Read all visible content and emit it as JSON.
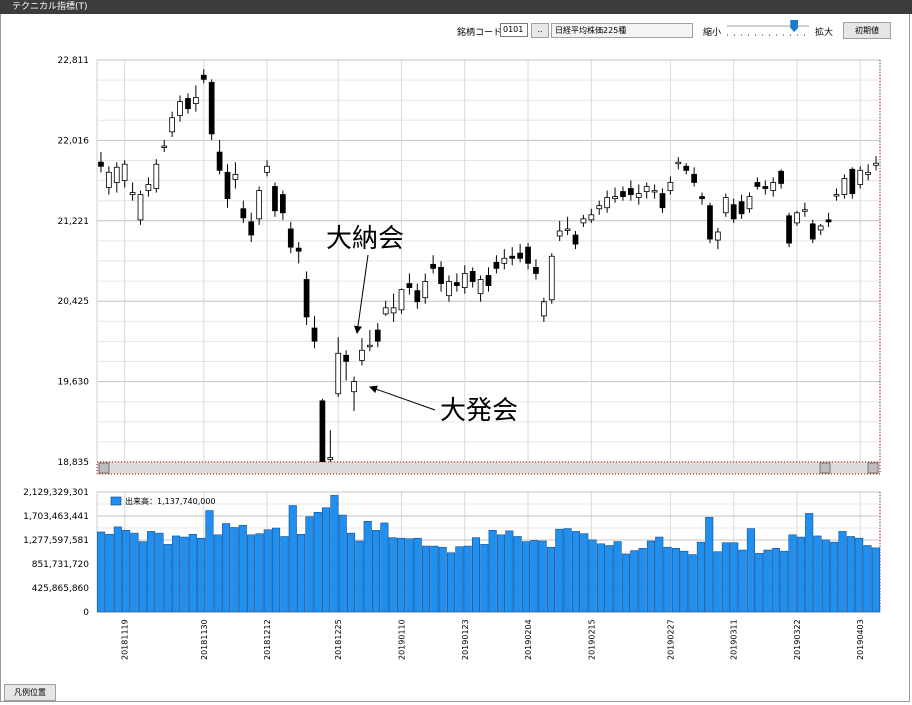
{
  "window": {
    "title": "テクニカル指標(T)"
  },
  "toolbar": {
    "code_label": "銘柄コード:",
    "code_value": "0101",
    "code_button": "..",
    "name_value": "日経平均株価225種",
    "zoom_out_label": "縮小",
    "zoom_in_label": "拡大",
    "zoom_level": 0.82,
    "reset_button": "初期値"
  },
  "footer": {
    "legend_button": "凡例位置"
  },
  "colors": {
    "volume_bar": "#1f8ff0",
    "up_body": "#ffffff",
    "down_body": "#000000",
    "grid": "#d9d9d9"
  },
  "chart_data": [
    {
      "type": "candlestick",
      "ylim": [
        18835,
        22811
      ],
      "yticks": [
        "22,811",
        "22,016",
        "21,221",
        "20,425",
        "19,630",
        "18,835"
      ],
      "annotations": [
        {
          "text": "大納会",
          "points_to": "20181228"
        },
        {
          "text": "大発会",
          "points_to": "20190104"
        }
      ],
      "candles": [
        [
          21800,
          21760,
          21900,
          21700
        ],
        [
          21550,
          21700,
          21760,
          21480
        ],
        [
          21600,
          21750,
          21800,
          21500
        ],
        [
          21620,
          21780,
          21820,
          21550
        ],
        [
          21480,
          21500,
          21600,
          21420
        ],
        [
          21230,
          21480,
          21520,
          21180
        ],
        [
          21520,
          21580,
          21650,
          21460
        ],
        [
          21540,
          21780,
          21830,
          21500
        ],
        [
          21950,
          21960,
          22020,
          21900
        ],
        [
          22100,
          22240,
          22300,
          22050
        ],
        [
          22260,
          22400,
          22460,
          22200
        ],
        [
          22430,
          22330,
          22480,
          22280
        ],
        [
          22380,
          22440,
          22560,
          22300
        ],
        [
          22660,
          22620,
          22720,
          22580
        ],
        [
          22590,
          22080,
          22620,
          22020
        ],
        [
          21900,
          21720,
          22020,
          21680
        ],
        [
          21700,
          21440,
          21780,
          21350
        ],
        [
          21630,
          21680,
          21800,
          21540
        ],
        [
          21340,
          21250,
          21420,
          21200
        ],
        [
          21210,
          21080,
          21300,
          21010
        ],
        [
          21240,
          21520,
          21560,
          21180
        ],
        [
          21700,
          21760,
          21820,
          21660
        ],
        [
          21560,
          21320,
          21600,
          21260
        ],
        [
          21480,
          21300,
          21520,
          21230
        ],
        [
          21140,
          20960,
          21210,
          20900
        ],
        [
          20950,
          20920,
          21010,
          20800
        ],
        [
          20640,
          20270,
          20720,
          20190
        ],
        [
          20160,
          20030,
          20280,
          19960
        ],
        [
          19440,
          18780,
          19460,
          18760
        ],
        [
          18860,
          18880,
          19150,
          18740
        ],
        [
          19510,
          19910,
          20070,
          19480
        ],
        [
          19890,
          19830,
          19940,
          19640
        ],
        [
          19530,
          19630,
          19680,
          19340
        ],
        [
          19840,
          19940,
          20060,
          19790
        ],
        [
          19980,
          19990,
          20140,
          19930
        ],
        [
          20140,
          20030,
          20210,
          19970
        ],
        [
          20300,
          20360,
          20430,
          20280
        ],
        [
          20310,
          20360,
          20500,
          20220
        ],
        [
          20340,
          20540,
          20550,
          20300
        ],
        [
          20600,
          20560,
          20700,
          20490
        ],
        [
          20530,
          20420,
          20600,
          20350
        ],
        [
          20460,
          20620,
          20700,
          20400
        ],
        [
          20790,
          20750,
          20880,
          20700
        ],
        [
          20760,
          20600,
          20820,
          20520
        ],
        [
          20480,
          20620,
          20680,
          20420
        ],
        [
          20610,
          20580,
          20700,
          20520
        ],
        [
          20560,
          20700,
          20780,
          20500
        ],
        [
          20720,
          20620,
          20760,
          20560
        ],
        [
          20500,
          20640,
          20680,
          20420
        ],
        [
          20680,
          20580,
          20760,
          20520
        ],
        [
          20810,
          20750,
          20880,
          20700
        ],
        [
          20800,
          20850,
          20940,
          20740
        ],
        [
          20870,
          20850,
          20960,
          20780
        ],
        [
          20900,
          20850,
          20990,
          20810
        ],
        [
          20960,
          20800,
          21000,
          20740
        ],
        [
          20760,
          20700,
          20840,
          20640
        ],
        [
          20280,
          20420,
          20460,
          20220
        ],
        [
          20440,
          20870,
          20900,
          20400
        ],
        [
          21070,
          21120,
          21220,
          21020
        ],
        [
          21140,
          21140,
          21260,
          21080
        ],
        [
          21080,
          20990,
          21120,
          20940
        ],
        [
          21200,
          21240,
          21280,
          21160
        ],
        [
          21230,
          21280,
          21340,
          21200
        ],
        [
          21340,
          21370,
          21420,
          21280
        ],
        [
          21350,
          21450,
          21520,
          21300
        ],
        [
          21440,
          21460,
          21550,
          21400
        ],
        [
          21510,
          21460,
          21560,
          21420
        ],
        [
          21540,
          21480,
          21620,
          21420
        ],
        [
          21450,
          21490,
          21580,
          21380
        ],
        [
          21510,
          21560,
          21600,
          21440
        ],
        [
          21520,
          21520,
          21580,
          21440
        ],
        [
          21490,
          21350,
          21540,
          21300
        ],
        [
          21520,
          21600,
          21660,
          21480
        ],
        [
          21800,
          21800,
          21850,
          21730
        ],
        [
          21760,
          21720,
          21790,
          21680
        ],
        [
          21680,
          21600,
          21750,
          21560
        ],
        [
          21460,
          21440,
          21500,
          21380
        ],
        [
          21370,
          21040,
          21400,
          21000
        ],
        [
          21030,
          21110,
          21150,
          20940
        ],
        [
          21300,
          21450,
          21490,
          21260
        ],
        [
          21380,
          21240,
          21440,
          21200
        ],
        [
          21410,
          21290,
          21480,
          21240
        ],
        [
          21340,
          21460,
          21500,
          21300
        ],
        [
          21600,
          21560,
          21650,
          21530
        ],
        [
          21560,
          21540,
          21620,
          21480
        ],
        [
          21520,
          21600,
          21650,
          21460
        ],
        [
          21710,
          21590,
          21730,
          21540
        ],
        [
          21270,
          21000,
          21300,
          20960
        ],
        [
          21200,
          21300,
          21320,
          21170
        ],
        [
          21320,
          21330,
          21400,
          21260
        ],
        [
          21190,
          21040,
          21230,
          21000
        ],
        [
          21130,
          21170,
          21190,
          21080
        ],
        [
          21230,
          21210,
          21300,
          21160
        ],
        [
          21470,
          21480,
          21540,
          21420
        ],
        [
          21480,
          21640,
          21680,
          21440
        ],
        [
          21730,
          21490,
          21750,
          21440
        ],
        [
          21580,
          21720,
          21760,
          21540
        ],
        [
          21680,
          21700,
          21780,
          21620
        ],
        [
          21770,
          21790,
          21860,
          21720
        ]
      ],
      "date_labels": [
        {
          "i": 3,
          "text": "20181119"
        },
        {
          "i": 13,
          "text": "20181130"
        },
        {
          "i": 21,
          "text": "20181212"
        },
        {
          "i": 30,
          "text": "20181225"
        },
        {
          "i": 38,
          "text": "20190110"
        },
        {
          "i": 46,
          "text": "20190123"
        },
        {
          "i": 54,
          "text": "20190204"
        },
        {
          "i": 62,
          "text": "20190215"
        },
        {
          "i": 72,
          "text": "20190227"
        },
        {
          "i": 80,
          "text": "20190311"
        },
        {
          "i": 88,
          "text": "20190322"
        },
        {
          "i": 96,
          "text": "20190403"
        }
      ]
    },
    {
      "type": "bar",
      "series": [
        {
          "name": "出来高",
          "latest_label": "出来高：1,137,740,000"
        }
      ],
      "ylim": [
        0,
        2129329301
      ],
      "yticks": [
        "2,129,329,301",
        "1,703,463,441",
        "1,277,597,581",
        "851,731,720",
        "425,865,860",
        "0"
      ],
      "values": [
        1420000000,
        1380000000,
        1510000000,
        1450000000,
        1400000000,
        1250000000,
        1430000000,
        1400000000,
        1200000000,
        1350000000,
        1330000000,
        1380000000,
        1310000000,
        1800000000,
        1370000000,
        1570000000,
        1500000000,
        1540000000,
        1370000000,
        1390000000,
        1460000000,
        1490000000,
        1340000000,
        1890000000,
        1380000000,
        1690000000,
        1770000000,
        1850000000,
        2070000000,
        1720000000,
        1400000000,
        1260000000,
        1610000000,
        1450000000,
        1580000000,
        1320000000,
        1310000000,
        1300000000,
        1310000000,
        1170000000,
        1170000000,
        1150000000,
        1050000000,
        1160000000,
        1170000000,
        1320000000,
        1200000000,
        1450000000,
        1370000000,
        1440000000,
        1340000000,
        1250000000,
        1270000000,
        1260000000,
        1150000000,
        1470000000,
        1480000000,
        1430000000,
        1390000000,
        1280000000,
        1210000000,
        1180000000,
        1250000000,
        1030000000,
        1090000000,
        1130000000,
        1260000000,
        1330000000,
        1150000000,
        1130000000,
        1080000000,
        1020000000,
        1240000000,
        1680000000,
        1070000000,
        1230000000,
        1230000000,
        1100000000,
        1480000000,
        1040000000,
        1100000000,
        1130000000,
        1080000000,
        1370000000,
        1330000000,
        1750000000,
        1350000000,
        1280000000,
        1240000000,
        1430000000,
        1340000000,
        1310000000,
        1180000000,
        1137740000
      ]
    }
  ]
}
